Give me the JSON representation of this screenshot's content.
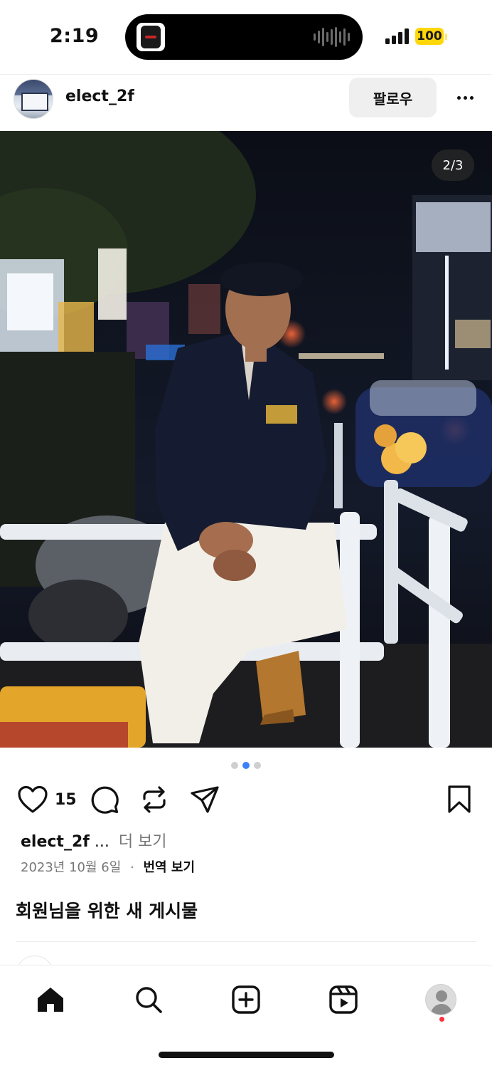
{
  "status_bar": {
    "time": "2:19",
    "battery": "100",
    "battery_color": "#ffd60a",
    "icons": [
      "now-playing-album-art",
      "audio-waveform-icon",
      "cellular-signal-icon",
      "battery-icon"
    ]
  },
  "post": {
    "username": "elect_2f",
    "follow_label": "팔로우",
    "more_icon": "more-horizontal-icon",
    "photo_description_icon": "post-photo",
    "carousel_counter": "2/3",
    "carousel_dots": {
      "total": 3,
      "active_index": 1
    },
    "accent_color": "#3b82f6",
    "like_count": "15",
    "action_icons": [
      "heart-icon",
      "comment-icon",
      "repost-icon",
      "share-icon",
      "bookmark-icon"
    ],
    "caption": {
      "user": "elect_2f",
      "ellipsis": "...",
      "more": "더 보기"
    },
    "date": "2023년 10월 6일",
    "separator": "·",
    "translate": "번역 보기"
  },
  "feed": {
    "section_title": "회원님을 위한 새 게시물"
  },
  "tab_bar": {
    "items": [
      {
        "name": "home",
        "icon": "home-icon",
        "active": true
      },
      {
        "name": "search",
        "icon": "search-icon"
      },
      {
        "name": "create",
        "icon": "create-plus-icon"
      },
      {
        "name": "reels",
        "icon": "reels-icon"
      },
      {
        "name": "profile",
        "icon": "profile-avatar"
      }
    ],
    "notification_color": "#ff3040"
  }
}
